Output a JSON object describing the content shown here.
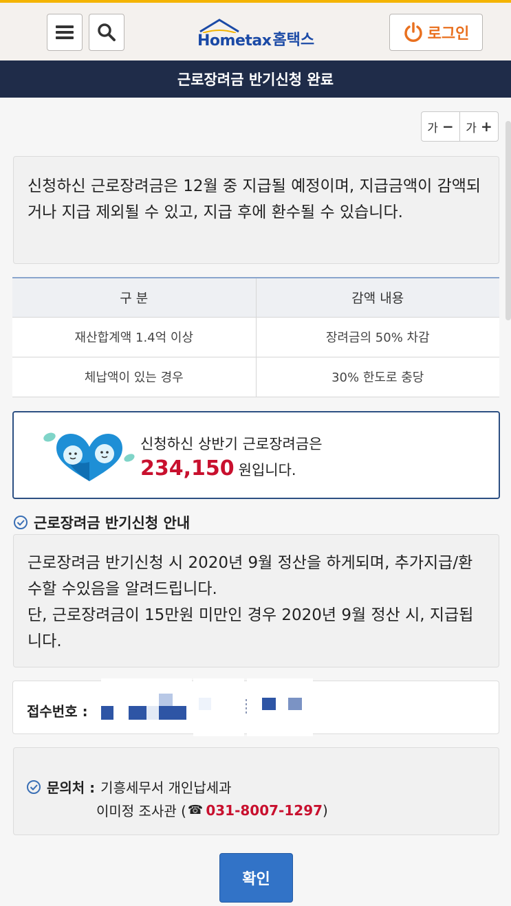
{
  "header": {
    "logo_text": "Hometax",
    "logo_kr": "홈택스",
    "login_label": "로그인"
  },
  "title": "근로장려금 반기신청 완료",
  "font_controls": {
    "smaller": "가",
    "larger": "가"
  },
  "notice": "신청하신 근로장려금은 12월 중 지급될 예정이며, 지급금액이 감액되거나 지급 제외될 수 있고, 지급 후에 환수될 수 있습니다.",
  "table": {
    "headers": [
      "구 분",
      "감액 내용"
    ],
    "rows": [
      [
        "재산합계액 1.4억 이상",
        "장려금의 50% 차감"
      ],
      [
        "체납액이 있는 경우",
        "30% 한도로 충당"
      ]
    ]
  },
  "amount": {
    "line1": "신청하신 상반기 근로장려금은",
    "value": "234,150",
    "unit": "원입니다."
  },
  "guide": {
    "heading": "근로장려금 반기신청 안내",
    "paragraph1": "근로장려금 반기신청 시 2020년 9월 정산을 하게되며, 추가지급/환수할 수있음을 알려드립니다.",
    "paragraph2": "단, 근로장려금이 15만원 미만인 경우 2020년 9월 정산 시, 지급됩니다."
  },
  "receipt": {
    "label": "접수번호 :"
  },
  "contact": {
    "label": "문의처 :",
    "office": "기흥세무서 개인납세과",
    "person": "이미정 조사관 (",
    "phone": "031-8007-1297",
    "close": ")"
  },
  "confirm_label": "확인",
  "colors": {
    "accent": "#c8102e",
    "navy": "#1f2c49",
    "brand_blue": "#1b4aa6",
    "login_orange": "#e9701f",
    "button_blue": "#3273c7"
  }
}
